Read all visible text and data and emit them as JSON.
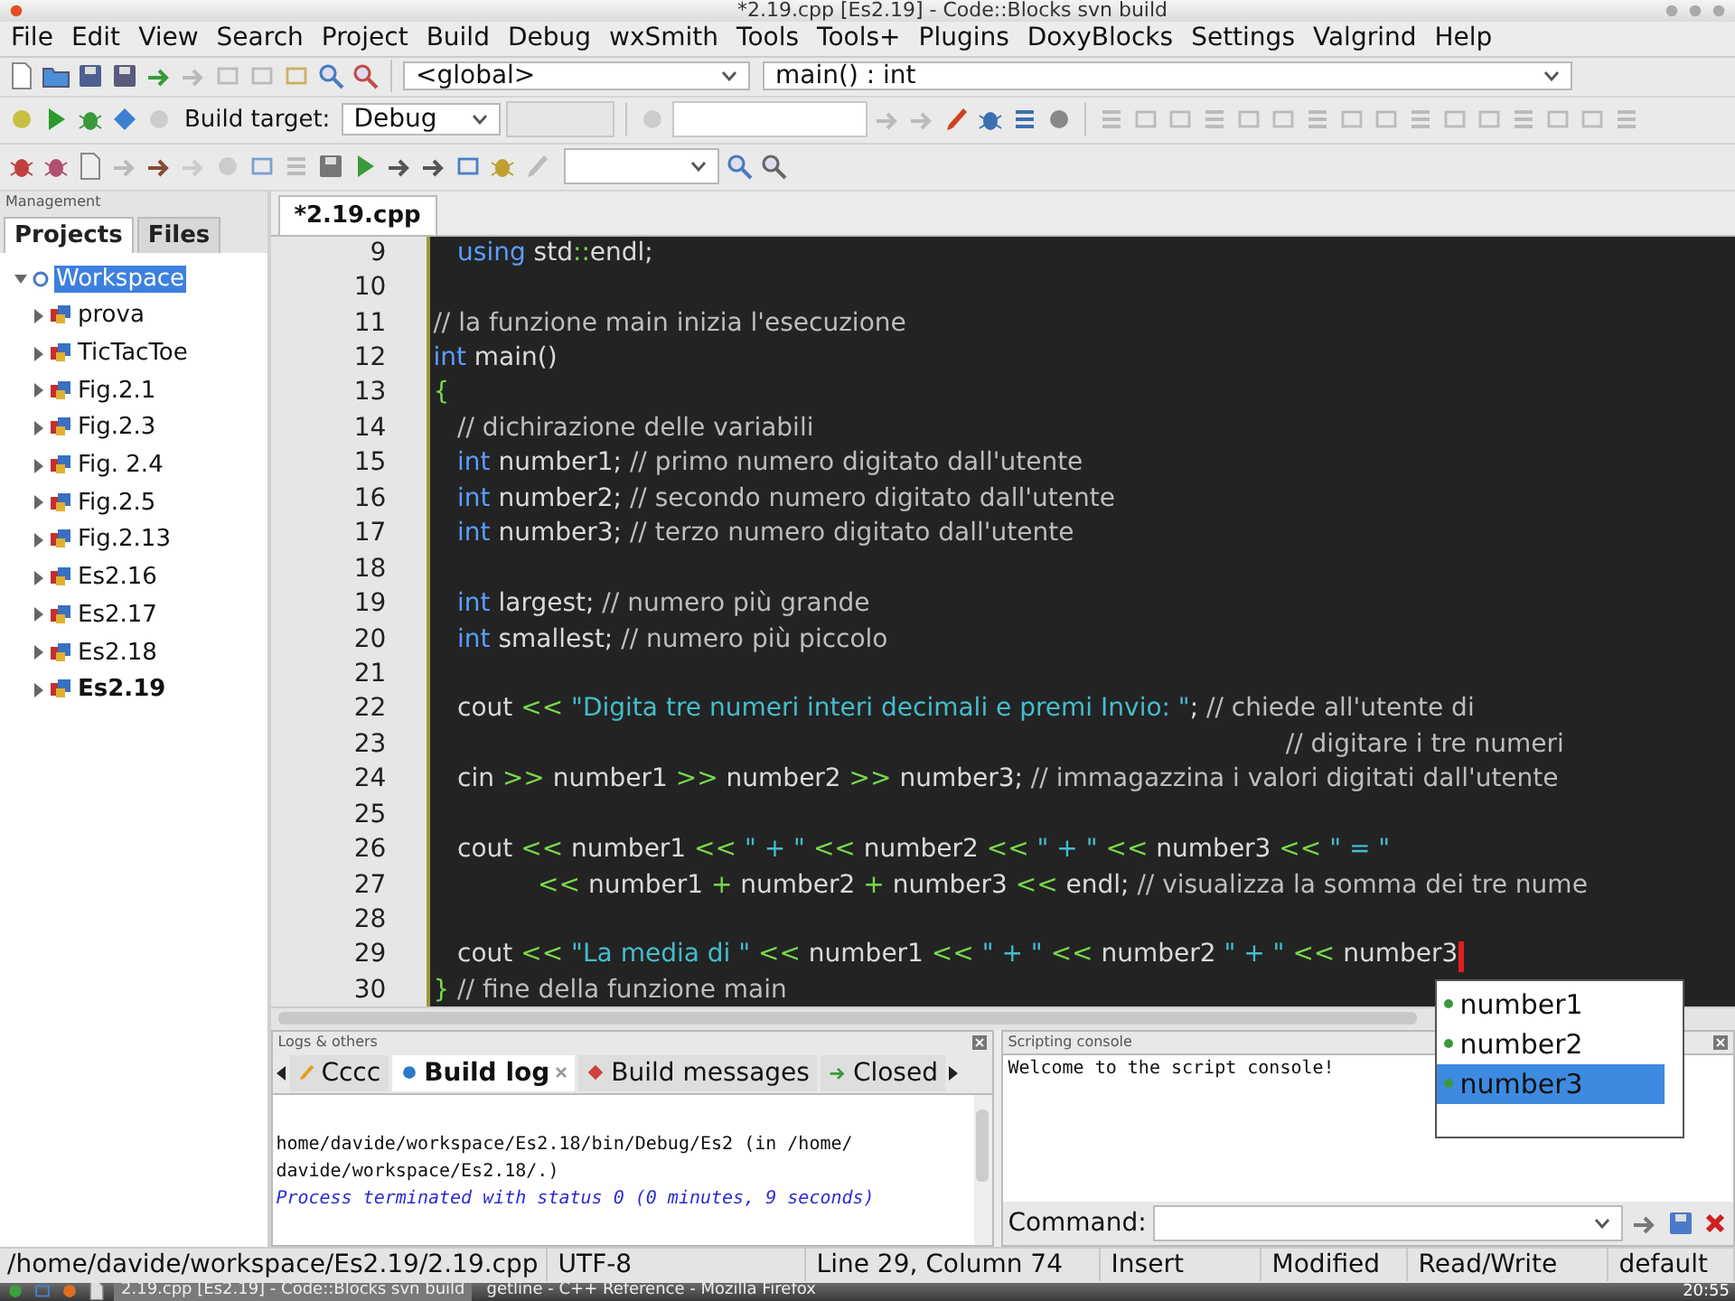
{
  "window": {
    "title": "*2.19.cpp [Es2.19] - Code::Blocks svn build"
  },
  "menu": [
    "File",
    "Edit",
    "View",
    "Search",
    "Project",
    "Build",
    "Debug",
    "wxSmith",
    "Tools",
    "Tools+",
    "Plugins",
    "DoxyBlocks",
    "Settings",
    "Valgrind",
    "Help"
  ],
  "toolbar": {
    "scope": "<global>",
    "function": "main() : int",
    "build_target_label": "Build target:",
    "build_target": "Debug"
  },
  "management": {
    "title": "Management",
    "tabs": [
      {
        "label": "Projects",
        "selected": true
      },
      {
        "label": "Files",
        "selected": false
      }
    ],
    "tree": [
      {
        "label": "Workspace",
        "selected": true,
        "expanded": true,
        "active": false,
        "children": [
          {
            "label": "prova",
            "selected": false,
            "expanded": false,
            "active": false
          },
          {
            "label": "TicTacToe",
            "selected": false,
            "expanded": false,
            "active": false
          },
          {
            "label": "Fig.2.1",
            "selected": false,
            "expanded": false,
            "active": false
          },
          {
            "label": "Fig.2.3",
            "selected": false,
            "expanded": false,
            "active": false
          },
          {
            "label": "Fig. 2.4",
            "selected": false,
            "expanded": false,
            "active": false
          },
          {
            "label": "Fig.2.5",
            "selected": false,
            "expanded": false,
            "active": false
          },
          {
            "label": "Fig.2.13",
            "selected": false,
            "expanded": false,
            "active": false
          },
          {
            "label": "Es2.16",
            "selected": false,
            "expanded": false,
            "active": false
          },
          {
            "label": "Es2.17",
            "selected": false,
            "expanded": false,
            "active": false
          },
          {
            "label": "Es2.18",
            "selected": false,
            "expanded": false,
            "active": false
          },
          {
            "label": "Es2.19",
            "selected": false,
            "expanded": false,
            "active": true
          }
        ]
      }
    ]
  },
  "editor": {
    "tabs": [
      {
        "label": "*2.19.cpp",
        "selected": true
      }
    ],
    "lines": [
      {
        "number": "9",
        "caret": false,
        "segments": [
          {
            "kind": "keyword",
            "text": "   using"
          },
          {
            "kind": "plain",
            "text": " std"
          },
          {
            "kind": "operator",
            "text": "::"
          },
          {
            "kind": "plain",
            "text": "endl;"
          }
        ]
      },
      {
        "number": "10",
        "caret": false
      },
      {
        "number": "11",
        "caret": false,
        "segments": [
          {
            "kind": "comment",
            "text": "// la funzione main inizia l'esecuzione"
          }
        ]
      },
      {
        "number": "12",
        "caret": false,
        "segments": [
          {
            "kind": "keyword",
            "text": "int"
          },
          {
            "kind": "plain",
            "text": " main()"
          }
        ]
      },
      {
        "number": "13",
        "caret": false,
        "segments": [
          {
            "kind": "operator",
            "text": "{"
          }
        ]
      },
      {
        "number": "14",
        "caret": false,
        "segments": [
          {
            "kind": "comment",
            "text": "   // dichirazione delle variabili"
          }
        ]
      },
      {
        "number": "15",
        "caret": false,
        "segments": [
          {
            "kind": "keyword",
            "text": "   int"
          },
          {
            "kind": "plain",
            "text": " number1;"
          },
          {
            "kind": "comment",
            "text": " // primo numero digitato dall'utente"
          }
        ]
      },
      {
        "number": "16",
        "caret": false,
        "segments": [
          {
            "kind": "keyword",
            "text": "   int"
          },
          {
            "kind": "plain",
            "text": " number2;"
          },
          {
            "kind": "comment",
            "text": " // secondo numero digitato dall'utente"
          }
        ]
      },
      {
        "number": "17",
        "caret": false,
        "segments": [
          {
            "kind": "keyword",
            "text": "   int"
          },
          {
            "kind": "plain",
            "text": " number3;"
          },
          {
            "kind": "comment",
            "text": " // terzo numero digitato dall'utente"
          }
        ]
      },
      {
        "number": "18",
        "caret": false
      },
      {
        "number": "19",
        "caret": false,
        "segments": [
          {
            "kind": "keyword",
            "text": "   int"
          },
          {
            "kind": "plain",
            "text": " largest;"
          },
          {
            "kind": "comment",
            "text": " // numero più grande"
          }
        ]
      },
      {
        "number": "20",
        "caret": false,
        "segments": [
          {
            "kind": "keyword",
            "text": "   int"
          },
          {
            "kind": "plain",
            "text": " smallest;"
          },
          {
            "kind": "comment",
            "text": " // numero più piccolo"
          }
        ]
      },
      {
        "number": "21",
        "caret": false
      },
      {
        "number": "22",
        "caret": false,
        "segments": [
          {
            "kind": "plain",
            "text": "   cout "
          },
          {
            "kind": "operator",
            "text": "<<"
          },
          {
            "kind": "string",
            "text": " \"Digita tre numeri interi decimali e premi Invio: \""
          },
          {
            "kind": "plain",
            "text": ";"
          },
          {
            "kind": "comment",
            "text": " // chiede all'utente di"
          }
        ]
      },
      {
        "number": "23",
        "caret": false,
        "segments": [
          {
            "kind": "comment",
            "text": "                                                                                                          // digitare i tre numeri"
          }
        ]
      },
      {
        "number": "24",
        "caret": false,
        "segments": [
          {
            "kind": "plain",
            "text": "   cin "
          },
          {
            "kind": "operator",
            "text": ">>"
          },
          {
            "kind": "plain",
            "text": " number1 "
          },
          {
            "kind": "operator",
            "text": ">>"
          },
          {
            "kind": "plain",
            "text": " number2 "
          },
          {
            "kind": "operator",
            "text": ">>"
          },
          {
            "kind": "plain",
            "text": " number3;"
          },
          {
            "kind": "comment",
            "text": " // immagazzina i valori digitati dall'utente"
          }
        ]
      },
      {
        "number": "25",
        "caret": false
      },
      {
        "number": "26",
        "caret": false,
        "segments": [
          {
            "kind": "plain",
            "text": "   cout "
          },
          {
            "kind": "operator",
            "text": "<<"
          },
          {
            "kind": "plain",
            "text": " number1 "
          },
          {
            "kind": "operator",
            "text": "<<"
          },
          {
            "kind": "string",
            "text": " \" + \" "
          },
          {
            "kind": "operator",
            "text": "<<"
          },
          {
            "kind": "plain",
            "text": " number2 "
          },
          {
            "kind": "operator",
            "text": "<<"
          },
          {
            "kind": "string",
            "text": " \" + \" "
          },
          {
            "kind": "operator",
            "text": "<<"
          },
          {
            "kind": "plain",
            "text": " number3 "
          },
          {
            "kind": "operator",
            "text": "<<"
          },
          {
            "kind": "string",
            "text": " \" = \""
          }
        ]
      },
      {
        "number": "27",
        "caret": false,
        "segments": [
          {
            "kind": "operator",
            "text": "             <<"
          },
          {
            "kind": "plain",
            "text": " number1 "
          },
          {
            "kind": "operator",
            "text": "+"
          },
          {
            "kind": "plain",
            "text": " number2 "
          },
          {
            "kind": "operator",
            "text": "+"
          },
          {
            "kind": "plain",
            "text": " number3 "
          },
          {
            "kind": "operator",
            "text": "<<"
          },
          {
            "kind": "plain",
            "text": " endl;"
          },
          {
            "kind": "comment",
            "text": " // visualizza la somma dei tre nume"
          }
        ]
      },
      {
        "number": "28",
        "caret": false
      },
      {
        "number": "29",
        "caret": true,
        "segments": [
          {
            "kind": "plain",
            "text": "   cout "
          },
          {
            "kind": "operator",
            "text": "<<"
          },
          {
            "kind": "string",
            "text": " \"La media di \" "
          },
          {
            "kind": "operator",
            "text": "<<"
          },
          {
            "kind": "plain",
            "text": " number1 "
          },
          {
            "kind": "operator",
            "text": "<<"
          },
          {
            "kind": "string",
            "text": " \" + \" "
          },
          {
            "kind": "operator",
            "text": "<<"
          },
          {
            "kind": "plain",
            "text": " number2 "
          },
          {
            "kind": "string",
            "text": "\" + \" "
          },
          {
            "kind": "operator",
            "text": "<<"
          },
          {
            "kind": "plain",
            "text": " number3"
          }
        ]
      },
      {
        "number": "30",
        "caret": false,
        "segments": [
          {
            "kind": "operator",
            "text": "}"
          },
          {
            "kind": "comment",
            "text": " // fine della funzione main"
          }
        ]
      }
    ],
    "autocomplete": [
      {
        "label": "number1",
        "selected": false
      },
      {
        "label": "number2",
        "selected": false
      },
      {
        "label": "number3",
        "selected": true
      }
    ]
  },
  "logs": {
    "title": "Logs & others",
    "tabs": [
      {
        "label": "Cccc",
        "selected": false,
        "closable": false
      },
      {
        "label": "Build log",
        "selected": true,
        "closable": true
      },
      {
        "label": "Build messages",
        "selected": false,
        "closable": false
      },
      {
        "label": "Closed",
        "selected": false,
        "closable": false
      }
    ],
    "lines": [
      {
        "kind": "plain",
        "text": "home/davide/workspace/Es2.18/bin/Debug/Es2  (in /home/"
      },
      {
        "kind": "plain",
        "text": "davide/workspace/Es2.18/.)"
      },
      {
        "kind": "status",
        "text": "Process terminated with status 0 (0 minutes, 9 seconds)"
      }
    ]
  },
  "console": {
    "title": "Scripting console",
    "output": "Welcome to the script console!",
    "command_label": "Command:"
  },
  "status_bar": [
    "/home/davide/workspace/Es2.19/2.19.cpp",
    "UTF-8",
    "Line 29, Column 74",
    "Insert",
    "Modified",
    "Read/Write",
    "default"
  ],
  "taskbar": {
    "windows": [
      {
        "label": "2.19.cpp [Es2.19] - Code::Blocks svn build",
        "selected": true
      },
      {
        "label": "getline - C++ Reference - Mozilla Firefox",
        "selected": false
      }
    ],
    "clock": "20:55"
  }
}
